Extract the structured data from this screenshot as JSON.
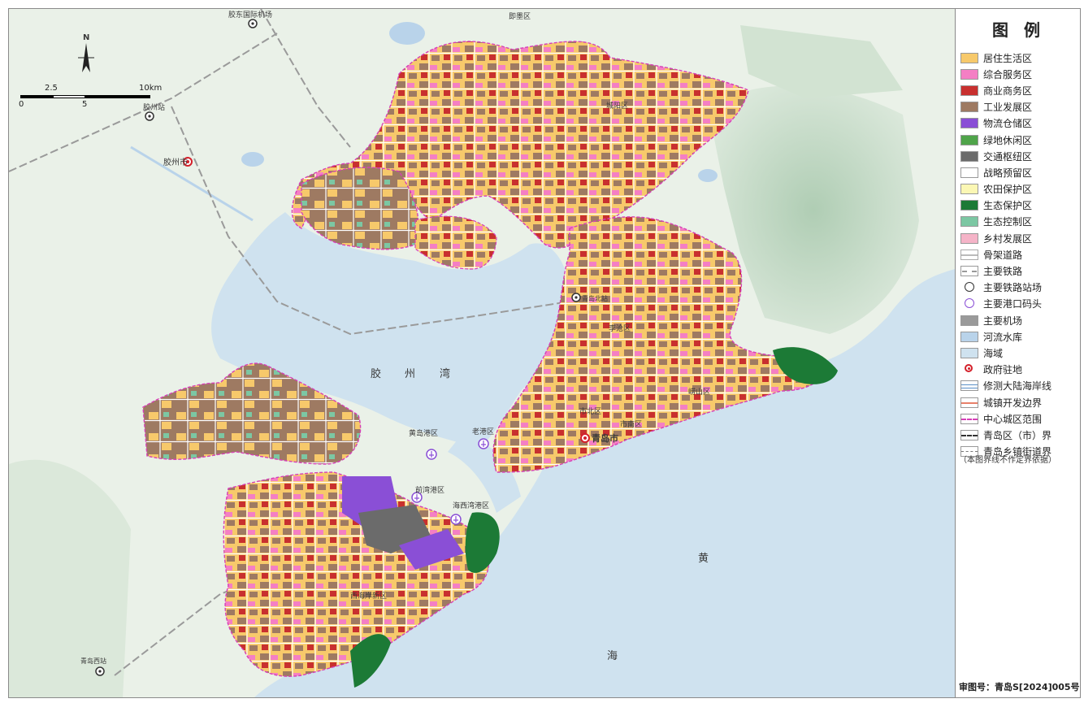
{
  "legend": {
    "title": "图  例",
    "items": [
      {
        "label": "居住生活区",
        "color": "#f7c96b",
        "kind": "fill"
      },
      {
        "label": "综合服务区",
        "color": "#f47fc4",
        "kind": "fill"
      },
      {
        "label": "商业商务区",
        "color": "#c8302f",
        "kind": "fill"
      },
      {
        "label": "工业发展区",
        "color": "#9e7a62",
        "kind": "fill"
      },
      {
        "label": "物流仓储区",
        "color": "#8a4fd6",
        "kind": "fill"
      },
      {
        "label": "绿地休闲区",
        "color": "#4fa44a",
        "kind": "fill"
      },
      {
        "label": "交通枢纽区",
        "color": "#6b6b6b",
        "kind": "fill"
      },
      {
        "label": "战略预留区",
        "color": "#ffffff",
        "kind": "fill"
      },
      {
        "label": "农田保护区",
        "color": "#fbf7b4",
        "kind": "fill"
      },
      {
        "label": "生态保护区",
        "color": "#1c7a36",
        "kind": "fill"
      },
      {
        "label": "生态控制区",
        "color": "#7cc7a3",
        "kind": "fill"
      },
      {
        "label": "乡村发展区",
        "color": "#f5b4c8",
        "kind": "fill"
      },
      {
        "label": "骨架道路",
        "color": "#ffffff",
        "kind": "road"
      },
      {
        "label": "主要铁路",
        "color": "#9a9a9a",
        "kind": "rail"
      },
      {
        "label": "主要铁路站场",
        "color": "#333333",
        "kind": "station"
      },
      {
        "label": "主要港口码头",
        "color": "#8a4fd6",
        "kind": "port"
      },
      {
        "label": "主要机场",
        "color": "#9a9a9a",
        "kind": "airport"
      },
      {
        "label": "河流水库",
        "color": "#b9d3ea",
        "kind": "fill"
      },
      {
        "label": "海域",
        "color": "#cfe2ef",
        "kind": "fill"
      },
      {
        "label": "政府驻地",
        "color": "#d4202a",
        "kind": "gov"
      },
      {
        "label": "修测大陆海岸线",
        "color": "#5a8fc7",
        "kind": "coast"
      },
      {
        "label": "城镇开发边界",
        "color": "#e8806a",
        "kind": "ubound"
      },
      {
        "label": "中心城区范围",
        "color": "#d63fb7",
        "kind": "center"
      },
      {
        "label": "青岛区（市）界",
        "color": "#333333",
        "kind": "district"
      },
      {
        "label": "青岛乡镇街道界",
        "color": "#777777",
        "kind": "town"
      }
    ],
    "note": "（本图界线不作定界依据）"
  },
  "approval_number": "审图号：青岛S[2024]005号",
  "compass": {
    "north_label": "N"
  },
  "scale": {
    "ticks": [
      "0",
      "2.5",
      "5",
      "10km"
    ]
  },
  "map_labels": {
    "jiaozhou_bay_1": "胶",
    "jiaozhou_bay_2": "州",
    "jiaozhou_bay_3": "湾",
    "huanghai_1": "黄",
    "huanghai_2": "海",
    "qingdao_city": "青岛市",
    "jiaozhou_city": "胶州市",
    "jiaozhou_station": "胶州站",
    "airport": "胶东国际机场",
    "jimo": "即墨区",
    "chengyang": "城阳区",
    "licang": "李沧区",
    "laoshan": "崂山区",
    "shinan": "市南区",
    "shibei": "市北区",
    "xihaian": "西海岸新区",
    "huangdao_port": "黄岛港区",
    "laogang": "老港区",
    "qianwan_port": "前湾港区",
    "haixiwan_port": "海西湾港区",
    "qingdao_north_station": "青岛北站",
    "qingdao_west_station": "青岛西站"
  },
  "colors": {
    "sea": "#cfe2ef",
    "land": "#eaf1e8",
    "hill": "#c6dcc8",
    "residential": "#f7c96b",
    "industrial": "#9e7a62",
    "service": "#f47fc4",
    "commerce": "#c8302f",
    "green": "#4fa44a",
    "eco": "#1c7a36",
    "ecoctrl": "#7cc7a3",
    "logistics": "#8a4fd6",
    "transport": "#6b6b6b",
    "boundary": "#d63fb7"
  }
}
